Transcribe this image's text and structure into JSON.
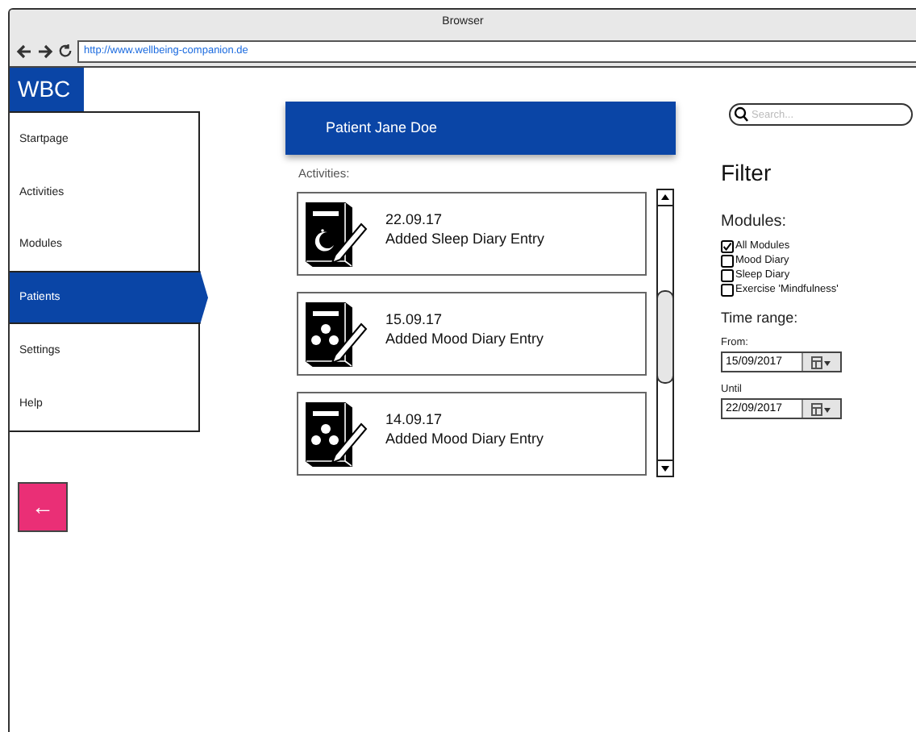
{
  "window": {
    "title": "Browser",
    "url": "http://www.wellbeing-companion.de"
  },
  "logo": "WBC",
  "nav": [
    {
      "label": "Startpage",
      "selected": false
    },
    {
      "label": "Activities",
      "selected": false
    },
    {
      "label": "Modules",
      "selected": false
    },
    {
      "label": "Patients",
      "selected": true
    },
    {
      "label": "Settings",
      "selected": false
    },
    {
      "label": "Help",
      "selected": false
    }
  ],
  "back_button": "←",
  "header": "Patient Jane Doe",
  "activities_label": "Activities:",
  "activities": [
    {
      "kind": "sleep",
      "date": "22.09.17",
      "text": "Added Sleep Diary Entry"
    },
    {
      "kind": "mood",
      "date": "15.09.17",
      "text": "Added Mood Diary Entry"
    },
    {
      "kind": "mood",
      "date": "14.09.17",
      "text": "Added Mood Diary Entry"
    }
  ],
  "search": {
    "placeholder": "Search..."
  },
  "filter": {
    "title": "Filter",
    "modules_label": "Modules:",
    "modules": [
      {
        "label": "All Modules",
        "checked": true
      },
      {
        "label": "Mood Diary",
        "checked": false
      },
      {
        "label": "Sleep Diary",
        "checked": false
      },
      {
        "label": "Exercise 'Mindfulness'",
        "checked": false
      }
    ],
    "time_range_label": "Time range:",
    "from_label": "From:",
    "from": "15/09/2017",
    "until_label": "Until",
    "until": "22/09/2017"
  }
}
